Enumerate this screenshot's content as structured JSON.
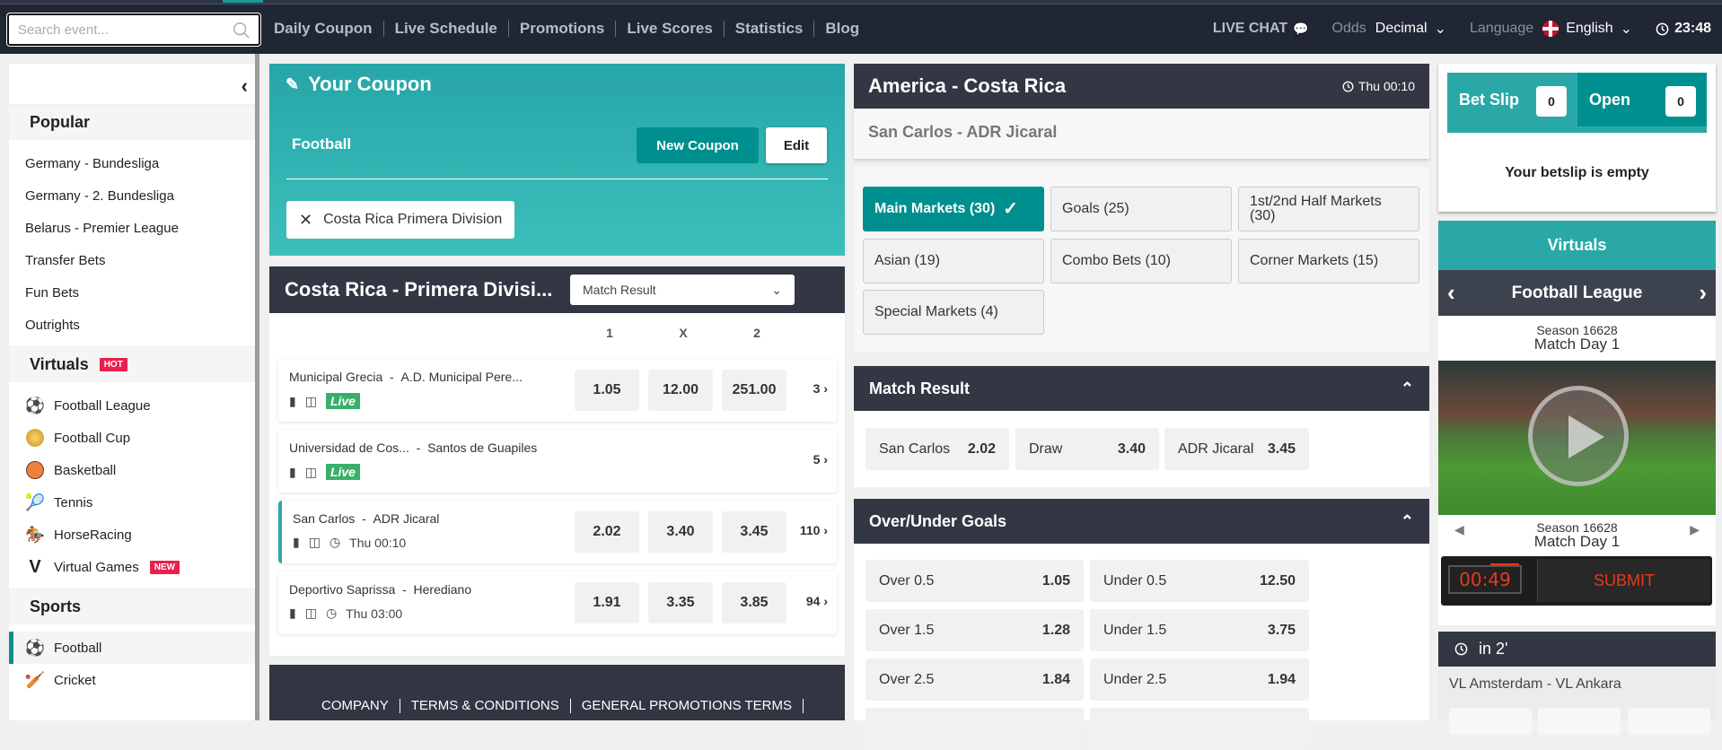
{
  "topbar": {
    "search_placeholder": "Search event...",
    "nav": [
      "Daily Coupon",
      "Live Schedule",
      "Promotions",
      "Live Scores",
      "Statistics",
      "Blog"
    ],
    "live_chat": "LIVE CHAT",
    "odds_label": "Odds",
    "odds_value": "Decimal",
    "language_label": "Language",
    "language_value": "English",
    "clock": "23:48"
  },
  "sidebar": {
    "popular_title": "Popular",
    "popular": [
      "Germany - Bundesliga",
      "Germany - 2. Bundesliga",
      "Belarus - Premier League",
      "Transfer Bets",
      "Fun Bets",
      "Outrights"
    ],
    "virtuals_title": "Virtuals",
    "virtuals_badge": "HOT",
    "virtuals": [
      {
        "label": "Football League",
        "icon": "soccer-ball-icon"
      },
      {
        "label": "Football Cup",
        "icon": "gold-ball-icon"
      },
      {
        "label": "Basketball",
        "icon": "basketball-icon"
      },
      {
        "label": "Tennis",
        "icon": "tennis-racket-icon"
      },
      {
        "label": "HorseRacing",
        "icon": "horse-racing-icon"
      },
      {
        "label": "Virtual Games",
        "icon": "virtual-games-icon",
        "badge": "NEW"
      }
    ],
    "sports_title": "Sports",
    "sports": [
      {
        "label": "Football",
        "icon": "soccer-ball-icon",
        "selected": true
      },
      {
        "label": "Cricket",
        "icon": "cricket-icon"
      }
    ]
  },
  "coupon": {
    "title": "Your Coupon",
    "sport": "Football",
    "new_coupon": "New Coupon",
    "edit": "Edit",
    "chip": "Costa Rica Primera Division"
  },
  "league": {
    "title": "Costa Rica - Primera Divisi...",
    "market_select": "Match Result",
    "columns": [
      "1",
      "X",
      "2"
    ],
    "events": [
      {
        "home": "Municipal Grecia",
        "away": "A.D. Municipal Pere...",
        "status": "Live",
        "odds": [
          "1.05",
          "12.00",
          "251.00"
        ],
        "more": "3"
      },
      {
        "home": "Universidad de Cos...",
        "away": "Santos de Guapiles",
        "status": "Live",
        "odds": [],
        "more": "5"
      },
      {
        "home": "San Carlos",
        "away": "ADR Jicaral",
        "time": "Thu 00:10",
        "odds": [
          "2.02",
          "3.40",
          "3.45"
        ],
        "more": "110",
        "selected": true
      },
      {
        "home": "Deportivo Saprissa",
        "away": "Herediano",
        "time": "Thu 03:00",
        "odds": [
          "1.91",
          "3.35",
          "3.85"
        ],
        "more": "94"
      }
    ],
    "separator": "-"
  },
  "footer": {
    "links": [
      "COMPANY",
      "TERMS & CONDITIONS",
      "GENERAL PROMOTIONS TERMS"
    ]
  },
  "event": {
    "region": "America - Costa Rica",
    "time": "Thu 00:10",
    "match": "San Carlos - ADR Jicaral",
    "markets": [
      "Main Markets (30)",
      "Goals (25)",
      "1st/2nd Half Markets (30)",
      "Asian (19)",
      "Combo Bets (10)",
      "Corner Markets (15)",
      "Special Markets (4)"
    ],
    "match_result": {
      "title": "Match Result",
      "outcomes": [
        {
          "label": "San Carlos",
          "odd": "2.02"
        },
        {
          "label": "Draw",
          "odd": "3.40"
        },
        {
          "label": "ADR Jicaral",
          "odd": "3.45"
        }
      ]
    },
    "over_under": {
      "title": "Over/Under Goals",
      "rows": [
        [
          {
            "label": "Over 0.5",
            "odd": "1.05"
          },
          {
            "label": "Under 0.5",
            "odd": "12.50"
          }
        ],
        [
          {
            "label": "Over 1.5",
            "odd": "1.28"
          },
          {
            "label": "Under 1.5",
            "odd": "3.75"
          }
        ],
        [
          {
            "label": "Over 2.5",
            "odd": "1.84"
          },
          {
            "label": "Under 2.5",
            "odd": "1.94"
          }
        ]
      ]
    }
  },
  "betslip": {
    "tab_betslip": "Bet Slip",
    "betslip_count": "0",
    "tab_open": "Open",
    "open_count": "0",
    "empty": "Your betslip is empty"
  },
  "virtuals_widget": {
    "title": "Virtuals",
    "league": "Football League",
    "season": "Season 16628",
    "matchday": "Match Day 1",
    "timer": "00:49",
    "submit": "SUBMIT",
    "next_in": "in 2'",
    "next_match": "VL Amsterdam - VL Ankara"
  }
}
